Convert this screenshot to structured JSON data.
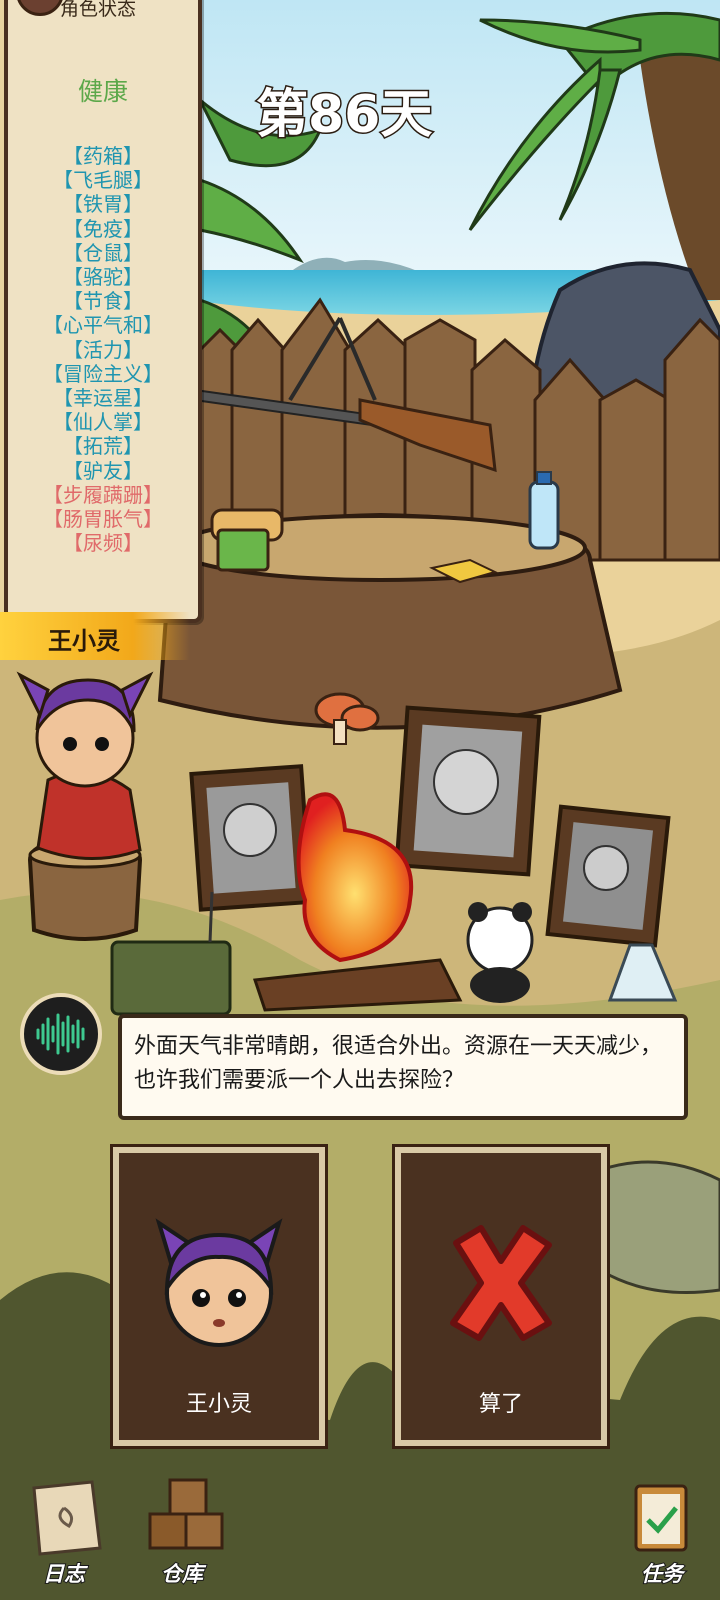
{
  "status_panel": {
    "title": "角色状态",
    "health": "健康",
    "perks": [
      {
        "label": "【药箱】",
        "type": "good"
      },
      {
        "label": "【飞毛腿】",
        "type": "good"
      },
      {
        "label": "【铁胃】",
        "type": "good"
      },
      {
        "label": "【免疫】",
        "type": "good"
      },
      {
        "label": "【仓鼠】",
        "type": "good"
      },
      {
        "label": "【骆驼】",
        "type": "good"
      },
      {
        "label": "【节食】",
        "type": "good"
      },
      {
        "label": "【心平气和】",
        "type": "good"
      },
      {
        "label": "【活力】",
        "type": "good"
      },
      {
        "label": "【冒险主义】",
        "type": "good"
      },
      {
        "label": "【幸运星】",
        "type": "good"
      },
      {
        "label": "【仙人掌】",
        "type": "good"
      },
      {
        "label": "【拓荒】",
        "type": "good"
      },
      {
        "label": "【驴友】",
        "type": "good"
      },
      {
        "label": "【步履蹒跚】",
        "type": "bad"
      },
      {
        "label": "【肠胃胀气】",
        "type": "bad"
      },
      {
        "label": "【尿频】",
        "type": "bad"
      }
    ],
    "character_name": "王小灵"
  },
  "day_label": "第86天",
  "dialog": {
    "text": "外面天气非常晴朗，很适合外出。资源在一天天减少，也许我们需要派一个人出去探险？"
  },
  "choices": [
    {
      "label": "王小灵",
      "icon": "character-portrait"
    },
    {
      "label": "算了",
      "icon": "red-x-icon"
    }
  ],
  "nav": {
    "log": "日志",
    "storage": "仓库",
    "tasks": "任务"
  },
  "colors": {
    "good_perk": "#1f95b0",
    "bad_perk": "#e06a6a",
    "health": "#5ca84a",
    "banner": "#f2a81a"
  }
}
